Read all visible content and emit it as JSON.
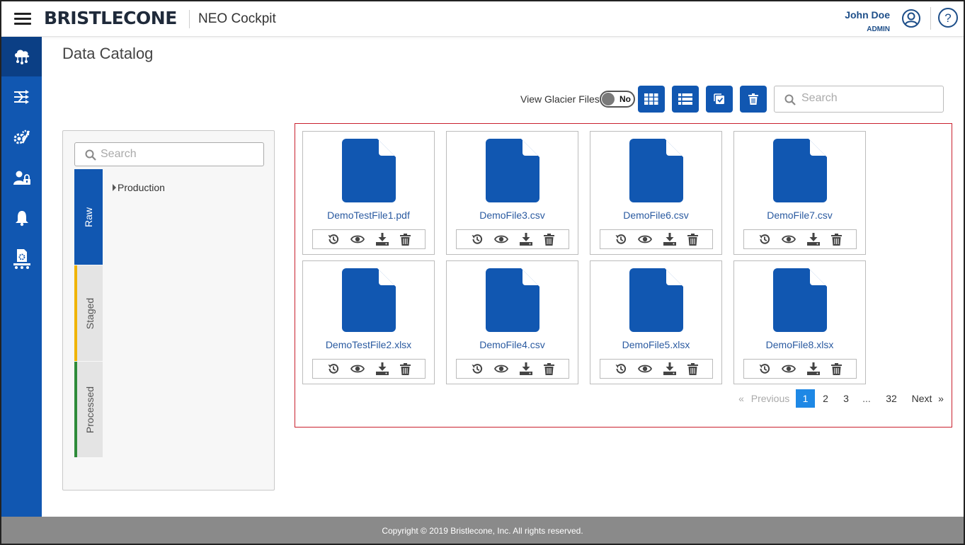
{
  "header": {
    "brand": "BRISTLECONE",
    "app_name": "NEO Cockpit",
    "user_name": "John Doe",
    "user_role": "ADMIN"
  },
  "page": {
    "title": "Data Catalog"
  },
  "toolbar": {
    "glacier_label": "View Glacier Files",
    "glacier_toggle": "No",
    "search_placeholder": "Search"
  },
  "tree": {
    "search_placeholder": "Search",
    "tabs": [
      "Raw",
      "Staged",
      "Processed"
    ],
    "nodes": [
      "Production"
    ]
  },
  "files": [
    "DemoTestFile1.pdf",
    "DemoFile3.csv",
    "DemoFile6.csv",
    "DemoFile7.csv",
    "DemoTestFile2.xlsx",
    "DemoFile4.csv",
    "DemoFile5.xlsx",
    "DemoFile8.xlsx"
  ],
  "pagination": {
    "first": "«",
    "previous": "Previous",
    "pages": [
      "1",
      "2",
      "3",
      "...",
      "32"
    ],
    "current": "1",
    "next": "Next",
    "last": "»"
  },
  "footer": {
    "copyright": "Copyright © 2019 Bristlecone, Inc. All rights reserved."
  },
  "colors": {
    "primary": "#1157b1",
    "accent": "#1e88e5",
    "highlight_border": "#c9202e",
    "staged": "#f0b400",
    "processed": "#2e8b3a"
  }
}
